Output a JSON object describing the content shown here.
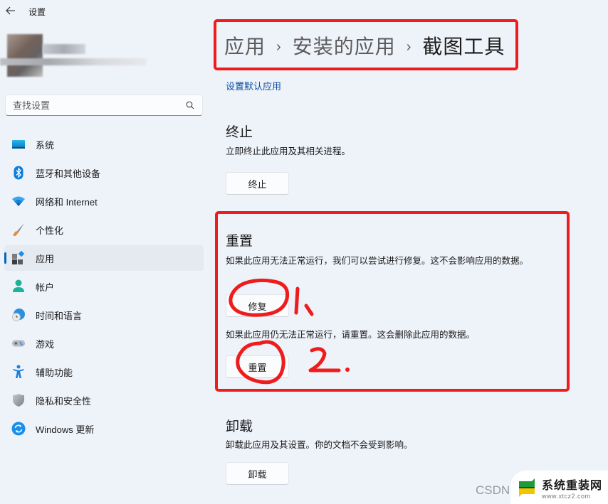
{
  "window": {
    "title": "设置",
    "back_icon": "arrow-left-icon"
  },
  "search": {
    "placeholder": "查找设置",
    "value": "",
    "icon": "search-icon"
  },
  "sidebar": {
    "items": [
      {
        "label": "系统",
        "icon": "system-icon",
        "active": false
      },
      {
        "label": "蓝牙和其他设备",
        "icon": "bluetooth-icon",
        "active": false
      },
      {
        "label": "网络和 Internet",
        "icon": "wifi-icon",
        "active": false
      },
      {
        "label": "个性化",
        "icon": "brush-icon",
        "active": false
      },
      {
        "label": "应用",
        "icon": "apps-icon",
        "active": true
      },
      {
        "label": "帐户",
        "icon": "account-icon",
        "active": false
      },
      {
        "label": "时间和语言",
        "icon": "time-language-icon",
        "active": false
      },
      {
        "label": "游戏",
        "icon": "gamepad-icon",
        "active": false
      },
      {
        "label": "辅助功能",
        "icon": "accessibility-icon",
        "active": false
      },
      {
        "label": "隐私和安全性",
        "icon": "shield-icon",
        "active": false
      },
      {
        "label": "Windows 更新",
        "icon": "windows-update-icon",
        "active": false
      }
    ],
    "accent_color": "#0067c0"
  },
  "breadcrumb": {
    "items": [
      "应用",
      "安装的应用",
      "截图工具"
    ],
    "separator": "›"
  },
  "links": {
    "set_default": "设置默认应用"
  },
  "sections": {
    "terminate": {
      "title": "终止",
      "description": "立即终止此应用及其相关进程。",
      "button": "终止"
    },
    "reset": {
      "title": "重置",
      "repair_description": "如果此应用无法正常运行，我们可以尝试进行修复。这不会影响应用的数据。",
      "repair_button": "修复",
      "reset_description": "如果此应用仍无法正常运行，请重置。这会删除此应用的数据。",
      "reset_button": "重置"
    },
    "uninstall": {
      "title": "卸载",
      "description": "卸载此应用及其设置。你的文档不会受到影响。",
      "button": "卸载"
    }
  },
  "annotations": {
    "color": "#ee1c1c",
    "step1": "1.",
    "step2": "2."
  },
  "watermark": {
    "csdn": "CSDN",
    "site_name": "系统重装网",
    "site_url": "www.xtcz2.com"
  }
}
